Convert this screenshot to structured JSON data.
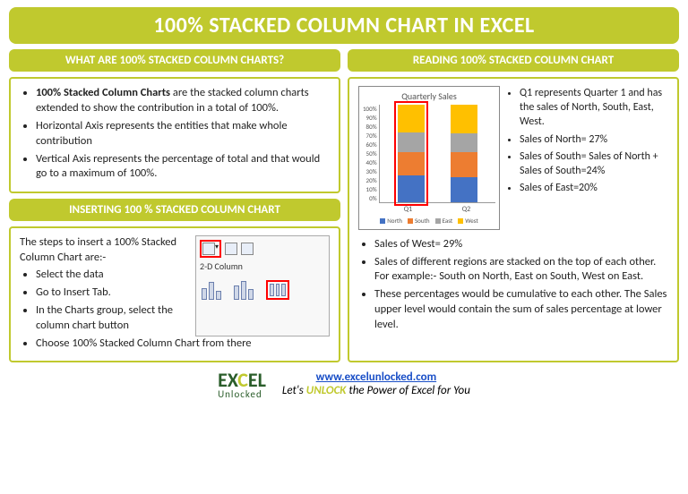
{
  "title": "100% STACKED COLUMN CHART IN EXCEL",
  "left": {
    "header1": "WHAT ARE 100% STACKED COLUMN CHARTS?",
    "def_bold": "100% Stacked Column Charts",
    "def_rest": " are the stacked column charts extended to show the contribution in a total of 100%.",
    "bullet2": "Horizontal Axis represents the entities that make whole contribution",
    "bullet3": "Vertical Axis represents the percentage of total and that would go to a maximum of 100%.",
    "header2": "INSERTING 100 % STACKED COLUMN CHART",
    "intro": "The steps to insert a 100% Stacked Column Chart are:-",
    "step1": "Select the data",
    "step2": "Go to Insert Tab.",
    "step3": "In the Charts group, select the column chart button",
    "step4": "Choose 100% Stacked Column Chart from there",
    "ribbon_label": "2-D Column"
  },
  "right": {
    "header": "READING 100% STACKED COLUMN CHART",
    "r1": "Q1 represents Quarter 1 and has the sales of North, South, East, West.",
    "r2": "Sales of North= 27%",
    "r3": "Sales of South= Sales of North + Sales of South=24%",
    "r4": "Sales of East=20%",
    "r5": "Sales of West= 29%",
    "r6": "Sales of different regions are stacked on the top of each other. For example:-  South on North, East on South, West on East.",
    "r7": "These percentages would be cumulative to each other. The Sales upper level would contain the sum of sales percentage at lower level."
  },
  "chart_data": {
    "type": "stacked-bar-100",
    "title": "Quarterly Sales",
    "categories": [
      "Q1",
      "Q2"
    ],
    "series": [
      {
        "name": "North",
        "color": "#4472c4",
        "values": [
          27,
          25
        ]
      },
      {
        "name": "South",
        "color": "#ed7d31",
        "values": [
          24,
          26
        ]
      },
      {
        "name": "East",
        "color": "#a5a5a5",
        "values": [
          20,
          19
        ]
      },
      {
        "name": "West",
        "color": "#ffc000",
        "values": [
          29,
          30
        ]
      }
    ],
    "ylim": [
      0,
      100
    ],
    "yticks": [
      "0%",
      "10%",
      "20%",
      "30%",
      "40%",
      "50%",
      "60%",
      "70%",
      "80%",
      "90%",
      "100%"
    ],
    "legend": [
      "North",
      "South",
      "East",
      "West"
    ]
  },
  "footer": {
    "logo_main": "EXCEL",
    "logo_sub": "Unlocked",
    "url": "www.excelunlocked.com",
    "tagline_pre": "Let's ",
    "tagline_unlock": "UNLOCK",
    "tagline_post": " the Power of Excel for You"
  }
}
